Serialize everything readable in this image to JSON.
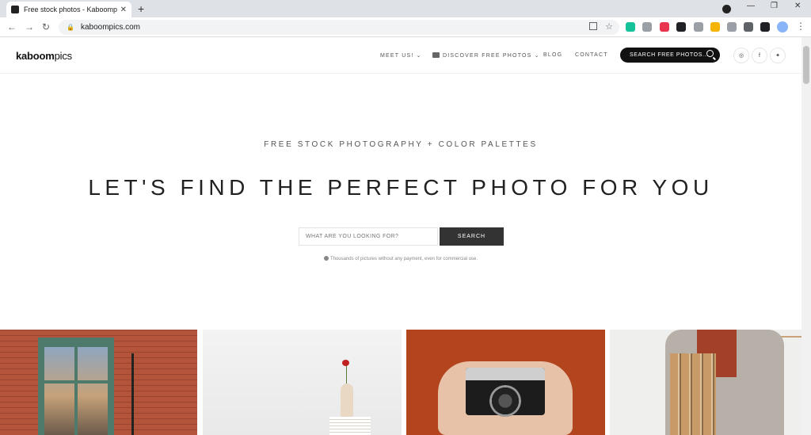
{
  "browser": {
    "tab_title": "Free stock photos - Kaboompics",
    "tab_close": "✕",
    "new_tab": "+",
    "url": "kaboompics.com",
    "back": "←",
    "forward": "→",
    "reload": "↻",
    "star": "☆",
    "lock": "🔒",
    "menu": "⋮",
    "minimize": "—",
    "restore": "❐",
    "close": "✕"
  },
  "extensions": [
    {
      "name": "grammarly-icon",
      "color": "#15c39a"
    },
    {
      "name": "extension-chat-icon",
      "color": "#9aa0a6"
    },
    {
      "name": "adblock-icon",
      "color": "#e8344e"
    },
    {
      "name": "extension-dark-icon",
      "color": "#202124"
    },
    {
      "name": "extension-badge-icon",
      "color": "#9aa0a6"
    },
    {
      "name": "color-wheel-icon",
      "color": "#f4b400"
    },
    {
      "name": "extension-code-icon",
      "color": "#9aa0a6"
    },
    {
      "name": "puzzle-icon",
      "color": "#5f6368"
    },
    {
      "name": "reading-list-icon",
      "color": "#202124"
    }
  ],
  "site": {
    "logo_bold": "kaboom",
    "logo_light": "pics",
    "nav": {
      "meet_us": "MEET US! ⌄",
      "discover": "DISCOVER FREE PHOTOS ⌄",
      "blog": "BLOG",
      "contact": "CONTACT"
    },
    "search_pill": "SEARCH FREE PHOTOS...",
    "social": {
      "instagram": "◎",
      "facebook": "f",
      "twitter": "✦"
    }
  },
  "hero": {
    "subtitle": "FREE STOCK PHOTOGRAPHY + COLOR PALETTES",
    "title": "LET'S FIND THE PERFECT PHOTO FOR YOU",
    "search_placeholder": "WHAT ARE YOU LOOKING FOR?",
    "search_button": "SEARCH",
    "hint": "Thousands of pictures without any payment, even for commercial use."
  },
  "colors": {
    "accent_dark": "#111111",
    "button": "#333333"
  }
}
